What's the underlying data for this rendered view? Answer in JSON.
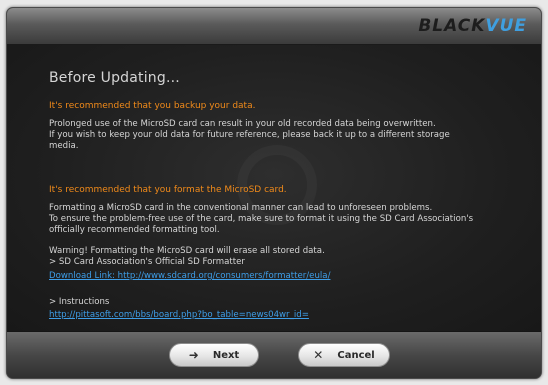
{
  "brand": {
    "part1": "BLACK",
    "part2": "VUE"
  },
  "heading": "Before Updating...",
  "backup": {
    "title": "It's recommended that you backup your data.",
    "lines": [
      "Prolonged use of the MicroSD card can result in your old recorded data being overwritten.",
      "If you wish to keep your old data for future reference, please back it up to a different storage",
      "media."
    ]
  },
  "format": {
    "title": "It's recommended that you format the MicroSD card.",
    "lines": [
      "Formatting a MicroSD card in the conventional manner can lead to unforeseen problems.",
      "To ensure the problem-free use of the card, make sure to format it using the SD Card Association's",
      "officially recommended formatting tool."
    ]
  },
  "warning": {
    "lines": [
      "Warning! Formatting the MicroSD card will erase all stored data.",
      "> SD Card Association's Official SD Formatter"
    ],
    "download_link": "Download Link: http://www.sdcard.org/consumers/formatter/eula/"
  },
  "instructions": {
    "label": "> Instructions",
    "link": "http://pittasoft.com/bbs/board.php?bo_table=news04wr_id="
  },
  "buttons": {
    "next": "Next",
    "cancel": "Cancel"
  }
}
